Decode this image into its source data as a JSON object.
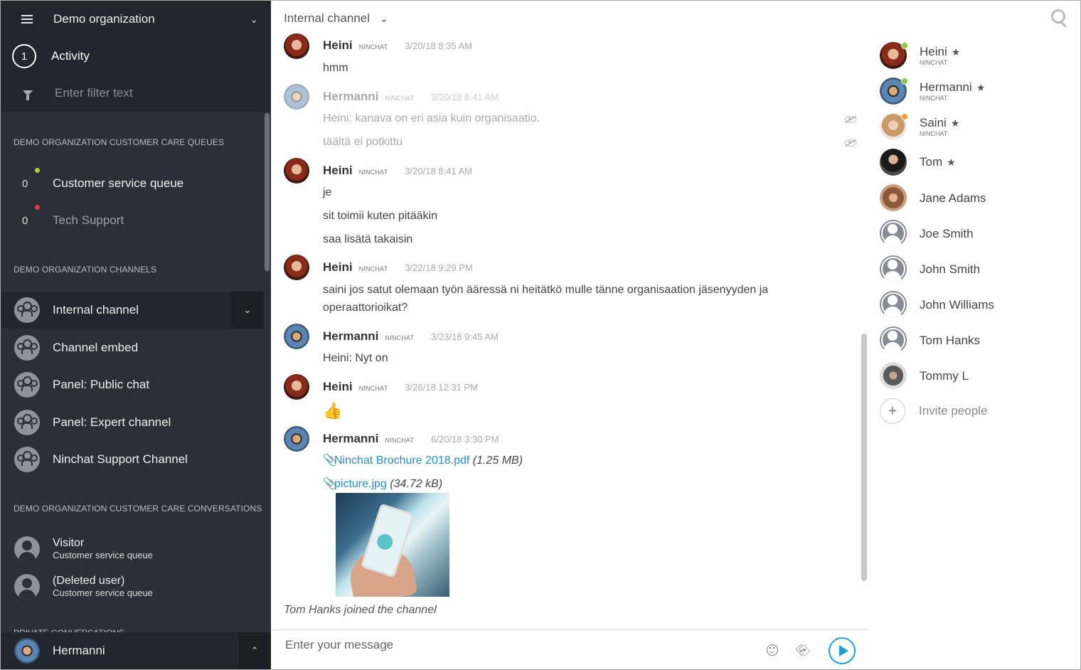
{
  "sidebar": {
    "org_name": "Demo organization",
    "activity": {
      "count": "1",
      "label": "Activity"
    },
    "filter_placeholder": "Enter filter text",
    "queues_title": "DEMO ORGANIZATION CUSTOMER CARE QUEUES",
    "queues": [
      {
        "count": "0",
        "label": "Customer service queue",
        "status_color": "#a6d32a"
      },
      {
        "count": "0",
        "label": "Tech Support",
        "status_color": "#e23a3a"
      }
    ],
    "channels_title": "DEMO ORGANIZATION CHANNELS",
    "channels": [
      {
        "label": "Internal channel"
      },
      {
        "label": "Channel embed"
      },
      {
        "label": "Panel: Public chat"
      },
      {
        "label": "Panel: Expert channel"
      },
      {
        "label": "Ninchat Support Channel"
      }
    ],
    "conversations_title": "DEMO ORGANIZATION CUSTOMER CARE CONVERSATIONS",
    "conversations": [
      {
        "name": "Visitor",
        "queue": "Customer service queue"
      },
      {
        "name": "(Deleted user)",
        "queue": "Customer service queue"
      }
    ],
    "private_title": "PRIVATE CONVERSATIONS",
    "current_user": "Hermanni"
  },
  "chat": {
    "title": "Internal channel",
    "messages": [
      {
        "name": "Heini",
        "badge": "NINCHAT",
        "time": "3/20/18 8:35 AM",
        "lines": [
          "hmm"
        ]
      },
      {
        "name": "Hermanni",
        "badge": "NINCHAT",
        "time": "3/20/18 8:41 AM",
        "lines": [
          "Heini: kanava on eri asia kuin organisaatio.",
          "täältä ei potkittu"
        ]
      },
      {
        "name": "Heini",
        "badge": "NINCHAT",
        "time": "3/20/18 8:41 AM",
        "lines": [
          "je",
          "sit toimii kuten pitääkin",
          "saa lisätä takaisin"
        ]
      },
      {
        "name": "Heini",
        "badge": "NINCHAT",
        "time": "3/22/18 9:29 PM",
        "lines": [
          "saini jos satut olemaan työn ääressä ni heitätkö mulle tänne organisaation jäsenyyden ja operaattorioikat?"
        ]
      },
      {
        "name": "Hermanni",
        "badge": "NINCHAT",
        "time": "3/23/18 9:45 AM",
        "lines": [
          "Heini: Nyt on"
        ]
      },
      {
        "name": "Heini",
        "badge": "NINCHAT",
        "time": "3/26/18 12:31 PM",
        "lines": [
          "👍"
        ]
      },
      {
        "name": "Hermanni",
        "badge": "NINCHAT",
        "time": "6/20/18 3:30 PM",
        "files": [
          {
            "name": "Ninchat Brochure 2018.pdf",
            "size": "1.25 MB"
          },
          {
            "name": "picture.jpg",
            "size": "34.72 kB"
          }
        ]
      }
    ],
    "join_notice": "Tom Hanks joined the channel",
    "composer_placeholder": "Enter your message"
  },
  "members": [
    {
      "name": "Heini",
      "badge": "NINCHAT",
      "star": "★",
      "status_color": "#8cc63f"
    },
    {
      "name": "Hermanni",
      "badge": "NINCHAT",
      "star": "★",
      "status_color": "#8cc63f"
    },
    {
      "name": "Saini",
      "badge": "NINCHAT",
      "star": "★",
      "status_color": "#f0a030"
    },
    {
      "name": "Tom",
      "star": "★"
    },
    {
      "name": "Jane Adams"
    },
    {
      "name": "Joe Smith"
    },
    {
      "name": "John Smith"
    },
    {
      "name": "John Williams"
    },
    {
      "name": "Tom Hanks"
    },
    {
      "name": "Tommy L"
    }
  ],
  "invite_label": "Invite people",
  "colors": {
    "sidebar_bg": "#2b2f38",
    "accent": "#1e9de0",
    "link": "#2b8cc4"
  },
  "icons": [
    "menu-icon",
    "chevron-down-icon",
    "filter-icon",
    "group-icon",
    "person-icon",
    "chevron-up-icon",
    "search-icon",
    "eye-off-icon",
    "paperclip-icon",
    "emoji-icon",
    "send-icon",
    "plus-icon",
    "star-icon"
  ]
}
